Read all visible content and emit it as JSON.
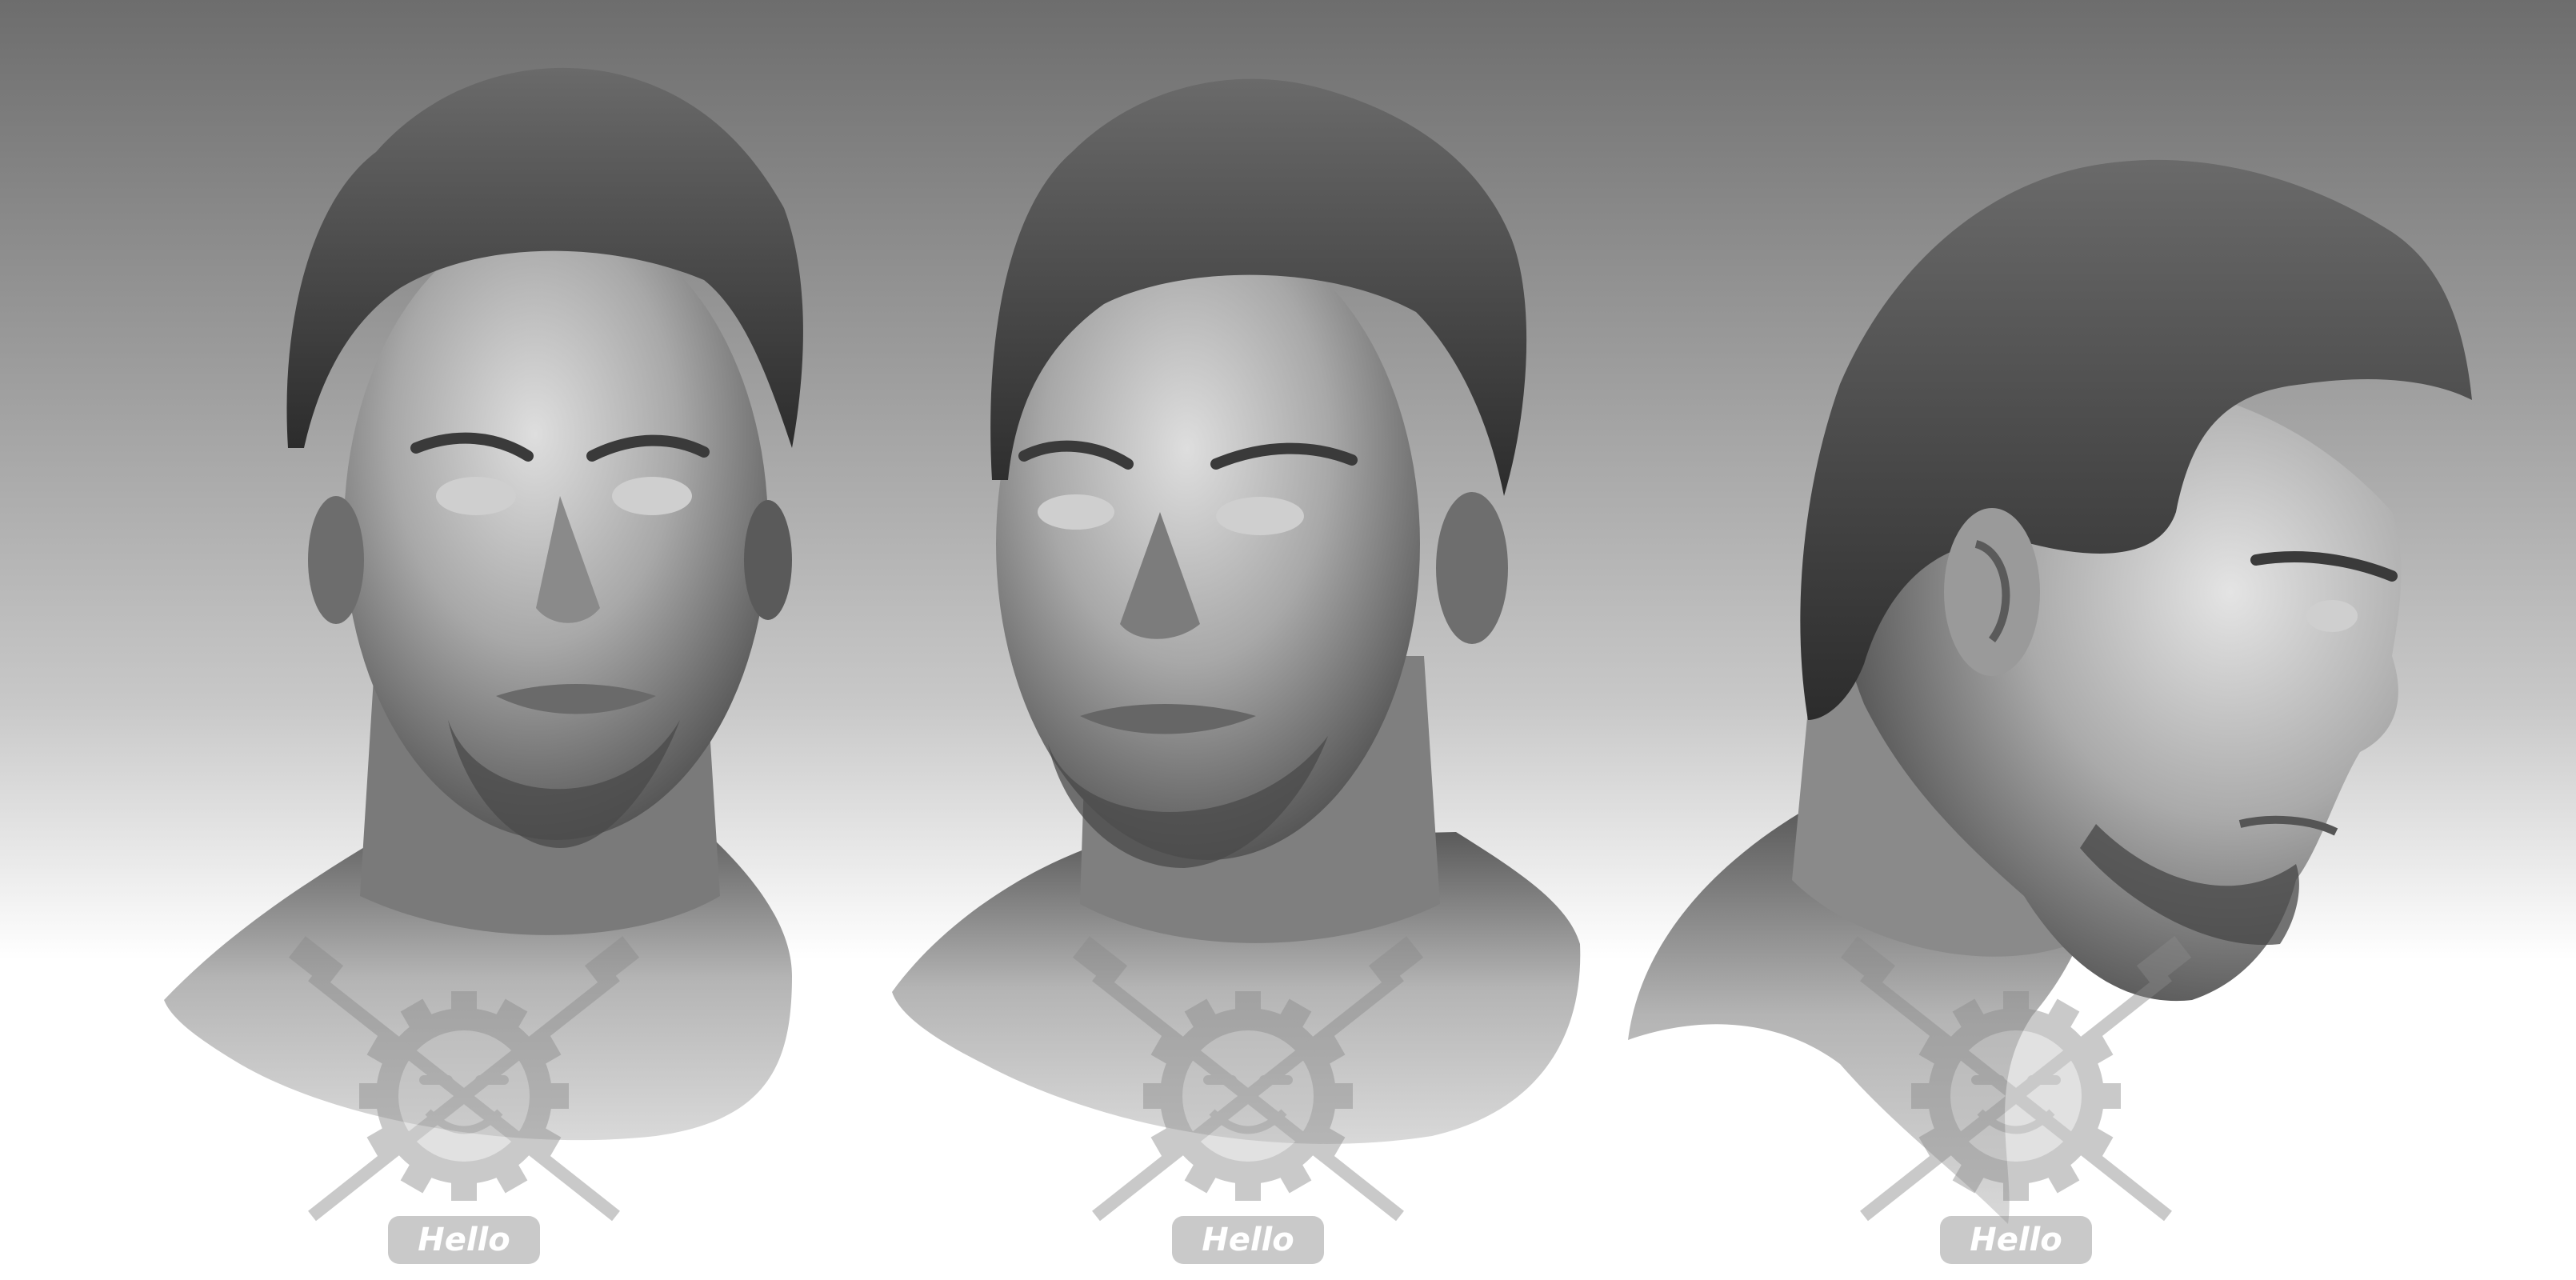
{
  "scene": {
    "subject": "three views of a grey digital sculpt of a man's head and shoulders",
    "views": [
      {
        "name": "front"
      },
      {
        "name": "three-quarter"
      },
      {
        "name": "profile"
      }
    ]
  },
  "watermark": {
    "text": "Hello",
    "repeat_count": 3,
    "icon": "gear-smiley-hammer-wrench-logo"
  },
  "colors": {
    "background_top": "#6d6d6d",
    "background_bottom": "#ffffff",
    "clay_light": "#dcdcdc",
    "clay_mid": "#a9a9a9",
    "clay_dark": "#3d3d3d",
    "hair": "#3a3a3a",
    "watermark": "#8a8a8a"
  }
}
